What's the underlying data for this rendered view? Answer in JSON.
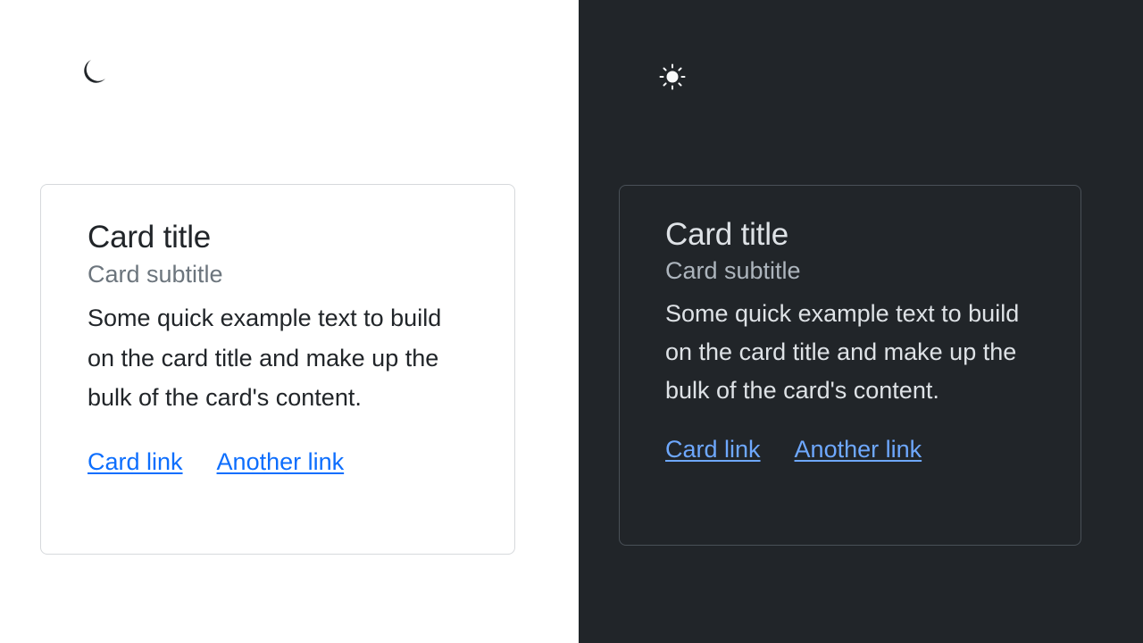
{
  "colors": {
    "light_background": "#ffffff",
    "dark_background": "#212529",
    "light_text": "#212529",
    "light_muted": "#6c757d",
    "light_link": "#0d6efd",
    "dark_text": "#dee2e6",
    "dark_muted": "#adb5bd",
    "dark_link": "#6ea8fe"
  },
  "light": {
    "theme_toggle_icon": "moon-icon",
    "card": {
      "title": "Card title",
      "subtitle": "Card subtitle",
      "text": "Some quick example text to build on the card title and make up the bulk of the card's content.",
      "links": [
        "Card link",
        "Another link"
      ]
    }
  },
  "dark": {
    "theme_toggle_icon": "sun-icon",
    "card": {
      "title": "Card title",
      "subtitle": "Card subtitle",
      "text": "Some quick example text to build on the card title and make up the bulk of the card's content.",
      "links": [
        "Card link",
        "Another link"
      ]
    }
  }
}
